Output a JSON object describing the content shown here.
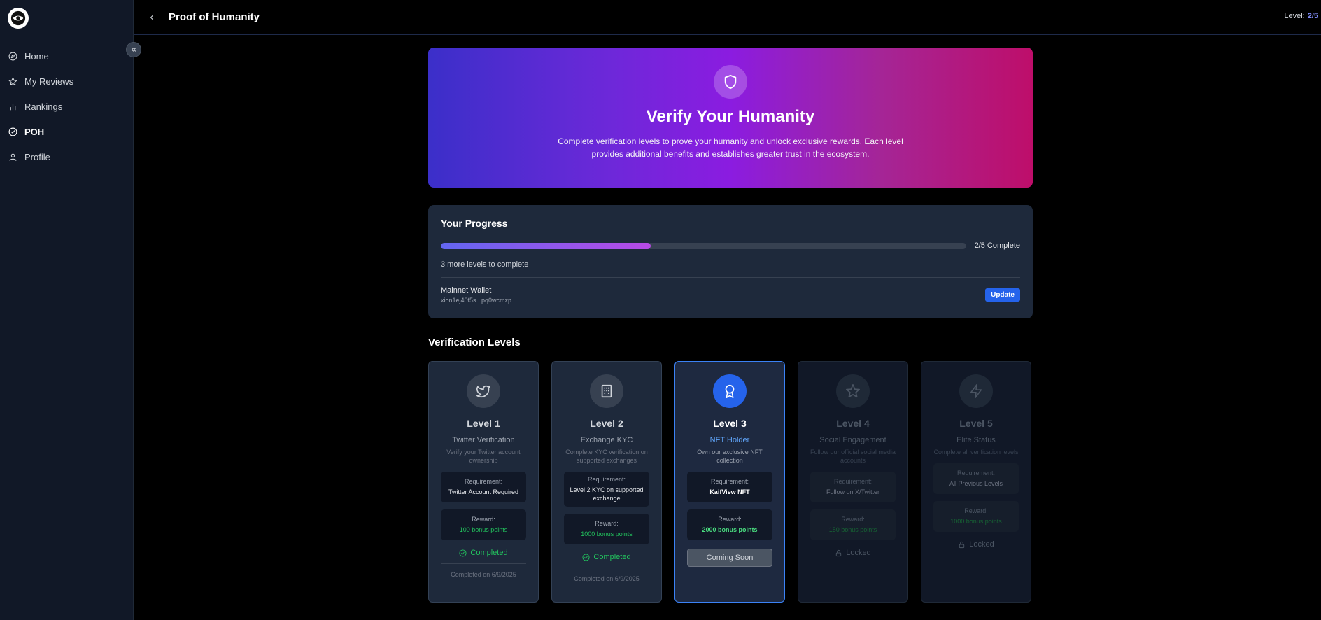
{
  "header": {
    "title": "Proof of Humanity",
    "level_label": "Level:",
    "level_value": "2/5"
  },
  "sidebar": {
    "items": [
      {
        "label": "Home",
        "icon": "compass-icon"
      },
      {
        "label": "My Reviews",
        "icon": "star-icon"
      },
      {
        "label": "Rankings",
        "icon": "bar-chart-icon"
      },
      {
        "label": "POH",
        "icon": "check-circle-icon",
        "active": true
      },
      {
        "label": "Profile",
        "icon": "user-icon"
      }
    ]
  },
  "hero": {
    "title": "Verify Your Humanity",
    "description": "Complete verification levels to prove your humanity and unlock exclusive rewards. Each level provides additional benefits and establishes greater trust in the ecosystem.",
    "icon": "shield-icon"
  },
  "progress": {
    "title": "Your Progress",
    "fraction": 0.4,
    "status": "2/5 Complete",
    "remaining": "3 more levels to complete",
    "wallet_label": "Mainnet Wallet",
    "wallet_address": "xion1ej40f5s...pq0wcmzp",
    "update_label": "Update"
  },
  "levels_title": "Verification Levels",
  "levels": [
    {
      "level": "Level 1",
      "name": "Twitter Verification",
      "desc": "Verify your Twitter account ownership",
      "req_label": "Requirement:",
      "requirement": "Twitter Account Required",
      "reward_label": "Reward:",
      "reward": "100 bonus points",
      "status": "Completed",
      "date": "Completed on 6/9/2025",
      "icon": "twitter-icon"
    },
    {
      "level": "Level 2",
      "name": "Exchange KYC",
      "desc": "Complete KYC verification on supported exchanges",
      "req_label": "Requirement:",
      "requirement": "Level 2 KYC on supported exchange",
      "reward_label": "Reward:",
      "reward": "1000 bonus points",
      "status": "Completed",
      "date": "Completed on 6/9/2025",
      "icon": "building-icon"
    },
    {
      "level": "Level 3",
      "name": "NFT Holder",
      "desc": "Own our exclusive NFT collection",
      "req_label": "Requirement:",
      "requirement": "KaifView NFT",
      "reward_label": "Reward:",
      "reward": "2000 bonus points",
      "button": "Coming Soon",
      "icon": "award-icon"
    },
    {
      "level": "Level 4",
      "name": "Social Engagement",
      "desc": "Follow our official social media accounts",
      "req_label": "Requirement:",
      "requirement": "Follow on X/Twitter",
      "reward_label": "Reward:",
      "reward": "150 bonus points",
      "status": "Locked",
      "icon": "star-icon"
    },
    {
      "level": "Level 5",
      "name": "Elite Status",
      "desc": "Complete all verification levels",
      "req_label": "Requirement:",
      "requirement": "All Previous Levels",
      "reward_label": "Reward:",
      "reward": "1000 bonus points",
      "status": "Locked",
      "icon": "zap-icon"
    }
  ],
  "colors": {
    "accent": "#2563eb",
    "success": "#22c55e",
    "progress_start": "#6366f1",
    "progress_end": "#b84ae6",
    "hero_start": "#3b2fc9",
    "hero_end": "#be0e6a"
  }
}
